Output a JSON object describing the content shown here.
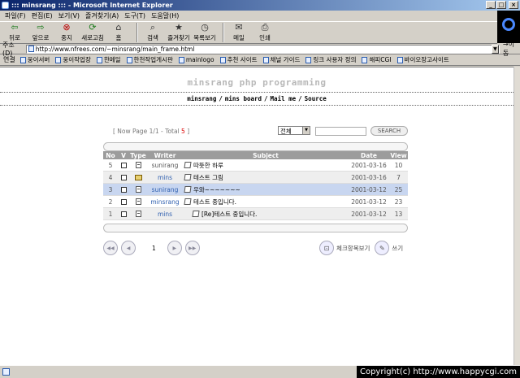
{
  "window": {
    "title": "::: minsrang ::: - Microsoft Internet Explorer"
  },
  "menu": [
    "파일(F)",
    "편집(E)",
    "보기(V)",
    "즐겨찾기(A)",
    "도구(T)",
    "도움말(H)"
  ],
  "toolbar": [
    {
      "icon": "back-arrow-icon",
      "label": "뒤로"
    },
    {
      "icon": "forward-arrow-icon",
      "label": "앞으로"
    },
    {
      "icon": "stop-icon",
      "label": "중지"
    },
    {
      "icon": "refresh-icon",
      "label": "새로고침"
    },
    {
      "icon": "home-icon",
      "label": "홈"
    },
    {
      "icon": "search-icon",
      "label": "검색"
    },
    {
      "icon": "favorites-icon",
      "label": "즐겨찾기"
    },
    {
      "icon": "history-icon",
      "label": "목록보기"
    },
    {
      "icon": "mail-icon",
      "label": "메일"
    },
    {
      "icon": "print-icon",
      "label": "인쇄"
    }
  ],
  "address": {
    "label": "주소(D)",
    "url": "http://www.nfrees.com/~minsrang/main_frame.html",
    "go": "이동"
  },
  "links": {
    "label": "연결",
    "items": [
      "웅이서버",
      "웅이작업장",
      "한메일",
      "한천작업게시판",
      "mainlogo",
      "추천 사이트",
      "채널 가이드",
      "링크 사용자 정의",
      "해피CGI",
      "바이오장고사이트"
    ]
  },
  "site": {
    "title": "minsrang php programming",
    "nav": [
      "minsrang",
      "mins board",
      "Mail me",
      "Source"
    ],
    "nav_sep": "/"
  },
  "board": {
    "page_prefix": "[ Now Page ",
    "page_current": "1",
    "page_sep": "/",
    "page_total_pages": "1",
    "total_label": " - Total ",
    "total": "5",
    "page_suffix": " ]",
    "search_select": "전체",
    "search_button": "SEARCH",
    "headers": {
      "no": "No",
      "v": "V",
      "type": "Type",
      "writer": "Writer",
      "subject": "Subject",
      "date": "Date",
      "view": "View"
    },
    "rows": [
      {
        "no": "5",
        "type": "doc",
        "writer": "sunirang",
        "subject": "따뜻한 하루",
        "date": "2001-03-16",
        "view": "10",
        "reply": false,
        "style": "normal",
        "writer_color": "gray"
      },
      {
        "no": "4",
        "type": "img",
        "writer": "mins",
        "subject": "테스트 그림",
        "date": "2001-03-16",
        "view": "7",
        "reply": false,
        "style": "alt",
        "writer_color": "blue"
      },
      {
        "no": "3",
        "type": "doc",
        "writer": "sunirang",
        "subject": "우와~~~~~~~",
        "date": "2001-03-12",
        "view": "25",
        "reply": false,
        "style": "hl",
        "writer_color": "blue"
      },
      {
        "no": "2",
        "type": "doc",
        "writer": "minsrang",
        "subject": "테스트 중입니다.",
        "date": "2001-03-12",
        "view": "23",
        "reply": false,
        "style": "normal",
        "writer_color": "blue"
      },
      {
        "no": "1",
        "type": "doc",
        "writer": "mins",
        "subject": "[Re]테스트 중입니다.",
        "date": "2001-03-12",
        "view": "13",
        "reply": true,
        "style": "alt",
        "writer_color": "blue"
      }
    ],
    "pager_current": "1",
    "checked_view_label": "체크항목보기",
    "write_label": "쓰기"
  },
  "status": {
    "copyright": "Copyright(c) http://www.happycgi.com"
  }
}
